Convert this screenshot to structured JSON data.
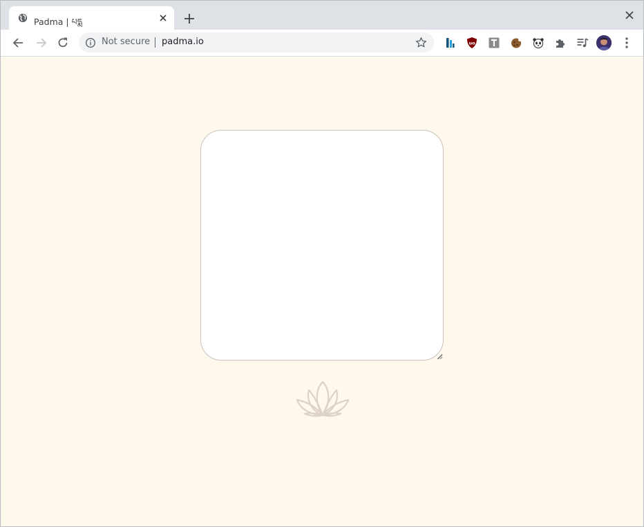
{
  "browser": {
    "tab": {
      "title": "Padma | པདྨ"
    },
    "address_bar": {
      "security_label": "Not secure",
      "url": "padma.io"
    },
    "extensions": [
      "bars-extension-icon",
      "ublock-icon",
      "text-t-icon",
      "cookie-icon",
      "panda-icon",
      "puzzle-icon",
      "media-queue-icon"
    ]
  },
  "page": {
    "editor": {
      "value": "",
      "placeholder": ""
    },
    "logo": "lotus-icon"
  },
  "colors": {
    "background": "#fff8ec",
    "editor_border": "#c8c2bc",
    "lotus": "#dcd2c6",
    "tabstrip": "#dee1e6"
  }
}
